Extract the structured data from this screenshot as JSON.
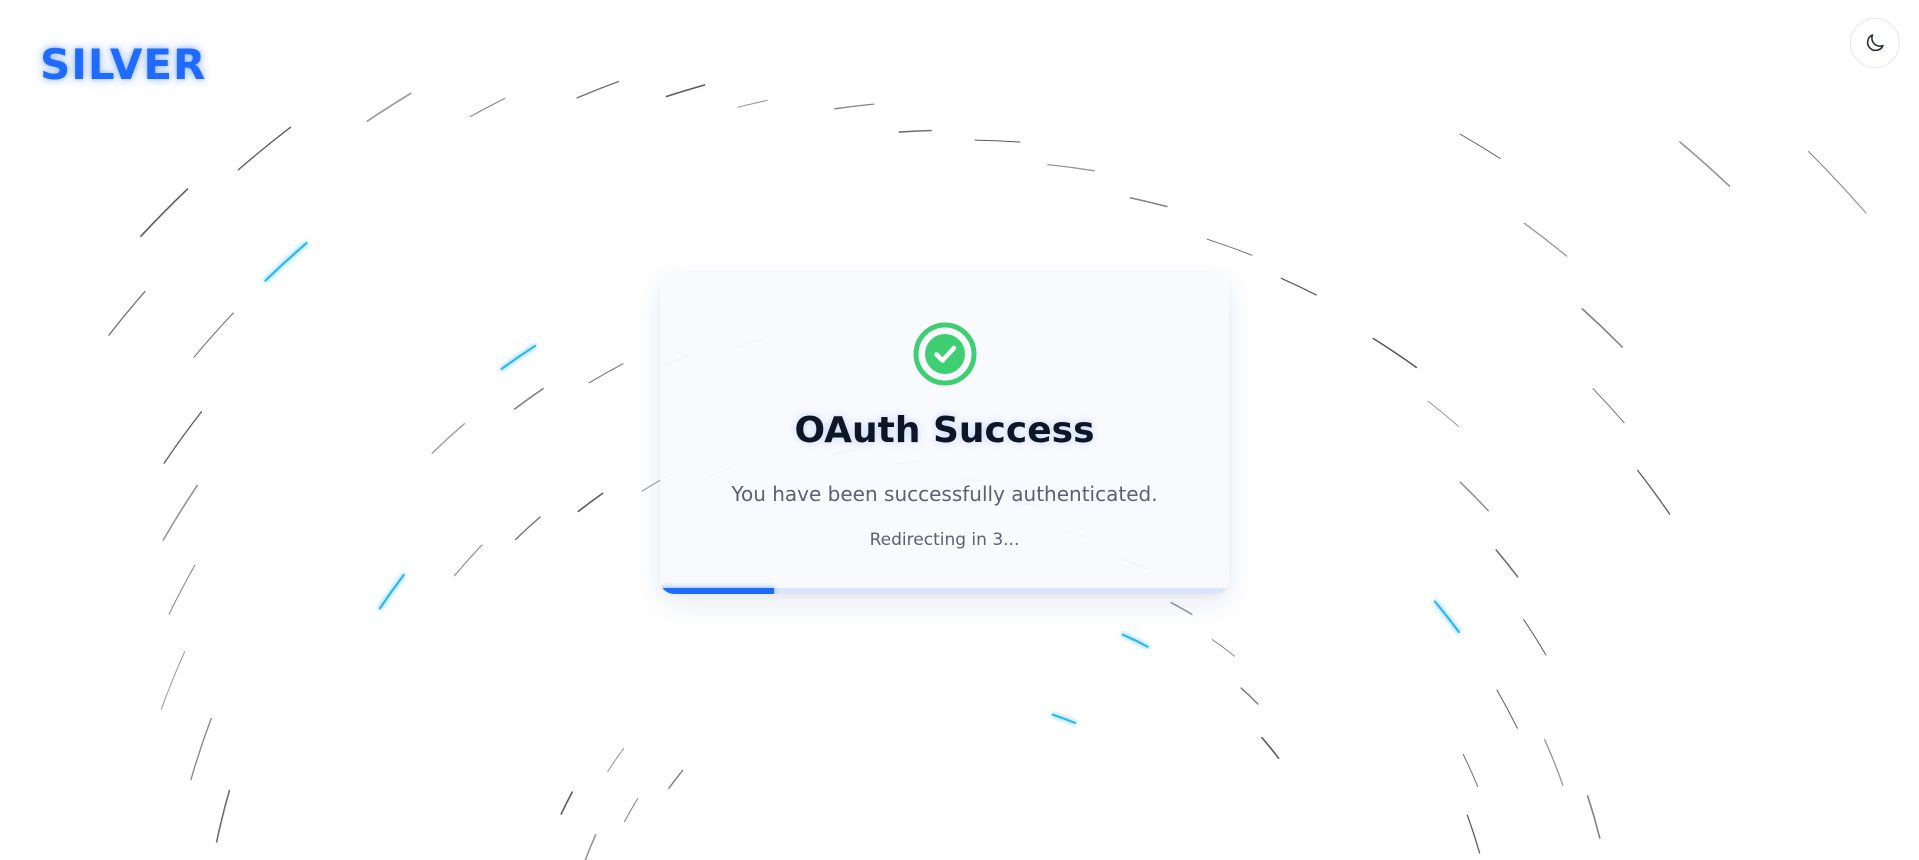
{
  "brand": {
    "logo_text": "SILVER",
    "accent_color": "#1f6bff"
  },
  "header": {
    "theme_toggle_icon": "moon-icon"
  },
  "card": {
    "status_icon": "check-circle-icon",
    "status_color": "#3ecf72",
    "title": "OAuth Success",
    "message": "You have been successfully authenticated.",
    "redirect_text": "Redirecting in 3...",
    "progress_fraction": 0.2
  },
  "background": {
    "trail_color": "#3a3f47",
    "highlight_color": "#1fb2f0"
  }
}
